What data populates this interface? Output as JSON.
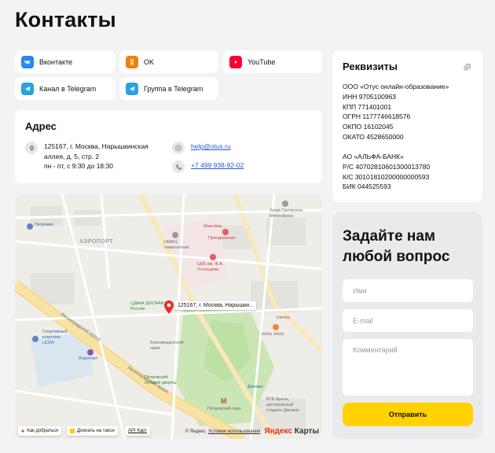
{
  "page": {
    "title": "Контакты"
  },
  "social": [
    {
      "label": "Вконтакте",
      "icon": "vk-icon",
      "color": "#2787f5"
    },
    {
      "label": "OK",
      "icon": "odnoklassniki-icon",
      "color": "#ee8208"
    },
    {
      "label": "YouTube",
      "icon": "youtube-icon",
      "color": "#ff0033"
    },
    {
      "label": "Канал в Telegram",
      "icon": "telegram-icon",
      "color": "#2aa3df"
    },
    {
      "label": "Группа в Telegram",
      "icon": "telegram-icon",
      "color": "#2aa3df"
    }
  ],
  "address": {
    "title": "Адрес",
    "line1": "125167, г. Москва, Нарышкинская",
    "line2": "аллея, д. 5, стр. 2",
    "hours": "пн - пт, с 9:30 до 18:30",
    "email": "help@otus.ru",
    "phone": "+7 499 938-92-02"
  },
  "requisites": {
    "title": "Реквизиты",
    "company": [
      "ООО «Отус онлайн-образование»",
      "ИНН 9705100963",
      "КПП 771401001",
      "ОГРН 1177746618576",
      "ОКПО 16102045",
      "ОКАТО 4528650000"
    ],
    "bank": [
      "АО «АЛЬФА-БАНК»",
      "Р/С 40702810601300013780",
      "К/С 30101810200000000593",
      "БИК 044525593"
    ]
  },
  "map": {
    "pin_label": "125167, г. Москва, Нарышки...",
    "labels": {
      "airport": "АЭРОПОРТ",
      "petrovka": "Петровка",
      "sport_center": "Спортивный\nкомплекс\nЦСКА",
      "dynamo": "Динамо",
      "aeroport_metro": "Аэропорт",
      "petrovsky_park": "Петровский парк",
      "vtb_arena": "ВТБ Арена,\nцентральный\nстадион Динамо",
      "petrovsky_palace": "Петровский\nпутевой дворец",
      "blagoveshchensky": "Благовещенский\nхрам",
      "nmic": "НМИЦ\nгематологии",
      "cdac": "ЦДАиК ДОСААФ\nРоссии",
      "hram_mitrofana": "Храм Святителя\nМитрофана",
      "maxima": "Максима",
      "preodolenie": "Преодоление",
      "ckb": "ЦКБ им. Ф.А.\nУсольцева",
      "jacky": "Jacky Jacky",
      "petrovsky_palace_metro": "Петровский парк",
      "leningradsky": "Ленинградский просп.",
      "leningradsky2": "Ленинградский просп.",
      "school": "Школа"
    },
    "route_btn": "Как добраться",
    "taxi_btn": "Доехать на такси",
    "api_link": "API Карт",
    "copyright": "© Яндекс",
    "terms": "Условия использования",
    "logo_a": "Яндекс",
    "logo_b": "Карты"
  },
  "form": {
    "title": "Задайте нам любой вопрос",
    "name_placeholder": "Имя",
    "email_placeholder": "E-mail",
    "comment_placeholder": "Комментарий",
    "submit": "Отправить"
  },
  "colors": {
    "accent": "#ffd200",
    "link": "#2b57d6"
  }
}
